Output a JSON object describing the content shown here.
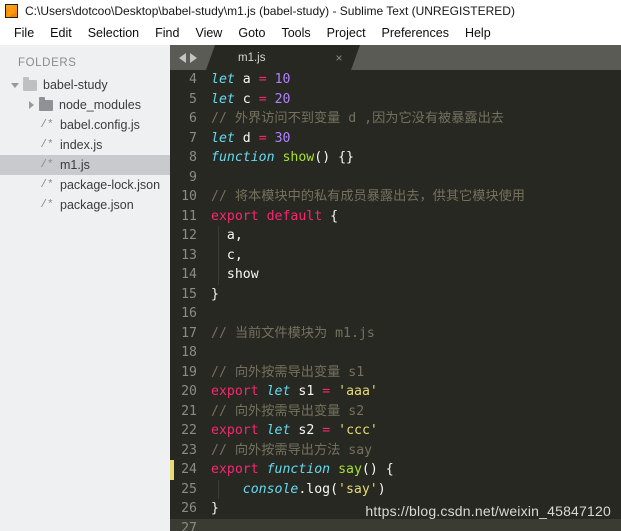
{
  "window": {
    "title": "C:\\Users\\dotcoo\\Desktop\\babel-study\\m1.js (babel-study) - Sublime Text (UNREGISTERED)",
    "app_icon": "sublime-text-logo"
  },
  "menubar": {
    "items": [
      "File",
      "Edit",
      "Selection",
      "Find",
      "View",
      "Goto",
      "Tools",
      "Project",
      "Preferences",
      "Help"
    ]
  },
  "sidebar": {
    "header": "FOLDERS",
    "items": [
      {
        "label": "babel-study",
        "icon": "folder-open-icon",
        "arrow": "chevron-down-icon",
        "indent": 0,
        "selected": false
      },
      {
        "label": "node_modules",
        "icon": "folder-closed-icon",
        "arrow": "chevron-right-icon",
        "indent": 1,
        "selected": false
      },
      {
        "label": "babel.config.js",
        "icon": "js-file-icon",
        "arrow": "",
        "indent": 2,
        "selected": false
      },
      {
        "label": "index.js",
        "icon": "js-file-icon",
        "arrow": "",
        "indent": 2,
        "selected": false
      },
      {
        "label": "m1.js",
        "icon": "js-file-icon",
        "arrow": "",
        "indent": 2,
        "selected": true
      },
      {
        "label": "package-lock.json",
        "icon": "js-file-icon",
        "arrow": "",
        "indent": 2,
        "selected": false
      },
      {
        "label": "package.json",
        "icon": "js-file-icon",
        "arrow": "",
        "indent": 2,
        "selected": false
      }
    ],
    "file_icon_glyph": "/*"
  },
  "tabbar": {
    "nav_prev": "arrow-left-icon",
    "nav_next": "arrow-right-icon",
    "tabs": [
      {
        "label": "m1.js",
        "close": "×",
        "active": true
      }
    ]
  },
  "editor": {
    "first_visible_line": 4,
    "current_line": 27,
    "marker_line": 24,
    "lines": [
      {
        "n": 4,
        "tokens": [
          {
            "t": "let",
            "c": "c-kw"
          },
          {
            "t": " ",
            "c": "c-plain"
          },
          {
            "t": "a",
            "c": "c-plain"
          },
          {
            "t": " ",
            "c": "c-plain"
          },
          {
            "t": "=",
            "c": "c-op"
          },
          {
            "t": " ",
            "c": "c-plain"
          },
          {
            "t": "10",
            "c": "c-num"
          }
        ]
      },
      {
        "n": 5,
        "tokens": [
          {
            "t": "let",
            "c": "c-kw"
          },
          {
            "t": " ",
            "c": "c-plain"
          },
          {
            "t": "c",
            "c": "c-plain"
          },
          {
            "t": " ",
            "c": "c-plain"
          },
          {
            "t": "=",
            "c": "c-op"
          },
          {
            "t": " ",
            "c": "c-plain"
          },
          {
            "t": "20",
            "c": "c-num"
          }
        ]
      },
      {
        "n": 6,
        "tokens": [
          {
            "t": "// 外界访问不到变量 d ,因为它没有被暴露出去",
            "c": "c-comment"
          }
        ]
      },
      {
        "n": 7,
        "tokens": [
          {
            "t": "let",
            "c": "c-kw"
          },
          {
            "t": " ",
            "c": "c-plain"
          },
          {
            "t": "d",
            "c": "c-plain"
          },
          {
            "t": " ",
            "c": "c-plain"
          },
          {
            "t": "=",
            "c": "c-op"
          },
          {
            "t": " ",
            "c": "c-plain"
          },
          {
            "t": "30",
            "c": "c-num"
          }
        ]
      },
      {
        "n": 8,
        "tokens": [
          {
            "t": "function",
            "c": "c-kw"
          },
          {
            "t": " ",
            "c": "c-plain"
          },
          {
            "t": "show",
            "c": "c-fn"
          },
          {
            "t": "() {}",
            "c": "c-plain"
          }
        ]
      },
      {
        "n": 9,
        "tokens": []
      },
      {
        "n": 10,
        "tokens": [
          {
            "t": "// 将本模块中的私有成员暴露出去，供其它模块使用",
            "c": "c-comment"
          }
        ]
      },
      {
        "n": 11,
        "tokens": [
          {
            "t": "export default",
            "c": "c-export"
          },
          {
            "t": " {",
            "c": "c-plain"
          }
        ]
      },
      {
        "n": 12,
        "tokens": [
          {
            "t": "  a,",
            "c": "c-plain"
          }
        ]
      },
      {
        "n": 13,
        "tokens": [
          {
            "t": "  c,",
            "c": "c-plain"
          }
        ]
      },
      {
        "n": 14,
        "tokens": [
          {
            "t": "  show",
            "c": "c-plain"
          }
        ]
      },
      {
        "n": 15,
        "tokens": [
          {
            "t": "}",
            "c": "c-plain"
          }
        ]
      },
      {
        "n": 16,
        "tokens": []
      },
      {
        "n": 17,
        "tokens": [
          {
            "t": "// 当前文件模块为 m1.js",
            "c": "c-comment"
          }
        ]
      },
      {
        "n": 18,
        "tokens": []
      },
      {
        "n": 19,
        "tokens": [
          {
            "t": "// 向外按需导出变量 s1",
            "c": "c-comment"
          }
        ]
      },
      {
        "n": 20,
        "tokens": [
          {
            "t": "export",
            "c": "c-export"
          },
          {
            "t": " ",
            "c": "c-plain"
          },
          {
            "t": "let",
            "c": "c-kw"
          },
          {
            "t": " ",
            "c": "c-plain"
          },
          {
            "t": "s1",
            "c": "c-plain"
          },
          {
            "t": " ",
            "c": "c-plain"
          },
          {
            "t": "=",
            "c": "c-op"
          },
          {
            "t": " ",
            "c": "c-plain"
          },
          {
            "t": "'aaa'",
            "c": "c-str"
          }
        ]
      },
      {
        "n": 21,
        "tokens": [
          {
            "t": "// 向外按需导出变量 s2",
            "c": "c-comment"
          }
        ]
      },
      {
        "n": 22,
        "tokens": [
          {
            "t": "export",
            "c": "c-export"
          },
          {
            "t": " ",
            "c": "c-plain"
          },
          {
            "t": "let",
            "c": "c-kw"
          },
          {
            "t": " ",
            "c": "c-plain"
          },
          {
            "t": "s2",
            "c": "c-plain"
          },
          {
            "t": " ",
            "c": "c-plain"
          },
          {
            "t": "=",
            "c": "c-op"
          },
          {
            "t": " ",
            "c": "c-plain"
          },
          {
            "t": "'ccc'",
            "c": "c-str"
          }
        ]
      },
      {
        "n": 23,
        "tokens": [
          {
            "t": "// 向外按需导出方法 say",
            "c": "c-comment"
          }
        ]
      },
      {
        "n": 24,
        "tokens": [
          {
            "t": "export",
            "c": "c-export"
          },
          {
            "t": " ",
            "c": "c-plain"
          },
          {
            "t": "function",
            "c": "c-kw"
          },
          {
            "t": " ",
            "c": "c-plain"
          },
          {
            "t": "say",
            "c": "c-fn"
          },
          {
            "t": "() {",
            "c": "c-plain"
          }
        ]
      },
      {
        "n": 25,
        "tokens": [
          {
            "t": "    ",
            "c": "c-plain"
          },
          {
            "t": "console",
            "c": "c-obj"
          },
          {
            "t": ".log(",
            "c": "c-plain"
          },
          {
            "t": "'say'",
            "c": "c-str"
          },
          {
            "t": ")",
            "c": "c-plain"
          }
        ]
      },
      {
        "n": 26,
        "tokens": [
          {
            "t": "}",
            "c": "c-plain"
          }
        ]
      },
      {
        "n": 27,
        "tokens": []
      }
    ]
  },
  "watermark": {
    "text": "https://blog.csdn.net/weixin_45847120"
  },
  "colors": {
    "editor_bg": "#272822",
    "sidebar_bg": "#eff0f1",
    "tabbar_bg": "#5a5b55",
    "accent_pink": "#f92672",
    "accent_cyan": "#66d9ef",
    "accent_green": "#a6e22e",
    "accent_yellow": "#e6db74",
    "accent_purple": "#ae81ff",
    "comment_gray": "#75715e",
    "marker_yellow": "#e6db74",
    "selection_gray": "#c9cace"
  }
}
